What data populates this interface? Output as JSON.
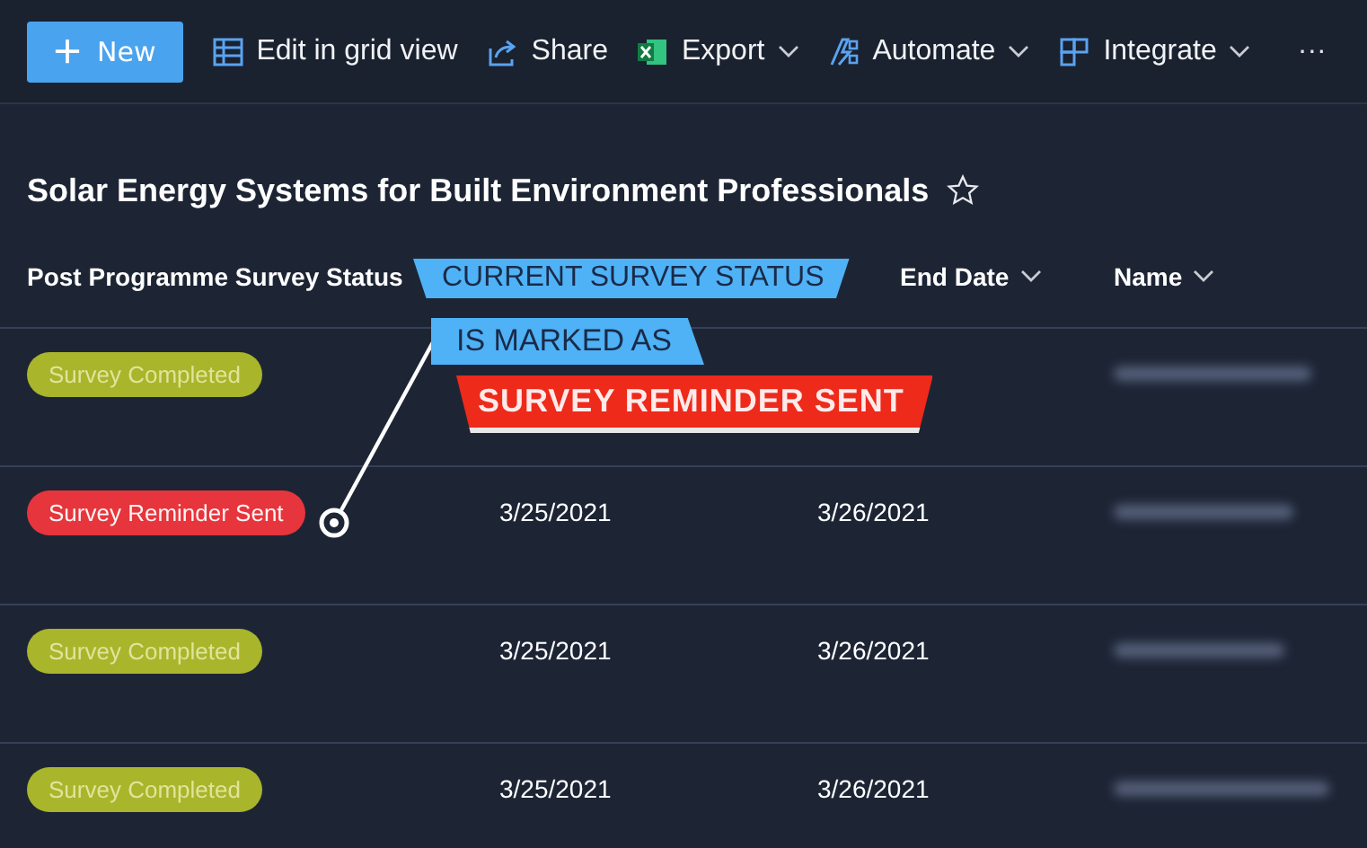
{
  "toolbar": {
    "new_button": "New",
    "items": [
      {
        "kind": "grid",
        "label": "Edit in grid view"
      },
      {
        "kind": "share",
        "label": "Share"
      },
      {
        "kind": "excel",
        "label": "Export",
        "dropdown": true
      },
      {
        "kind": "automate",
        "label": "Automate",
        "dropdown": true
      },
      {
        "kind": "integrate",
        "label": "Integrate",
        "dropdown": true
      }
    ],
    "more": "···"
  },
  "list_title": "Solar Energy Systems for Built Environment Professionals",
  "favorite": false,
  "table": {
    "columns": [
      {
        "label": "Post Programme Survey Status",
        "sortable": false
      },
      {
        "label": "End Date",
        "sortable": true
      },
      {
        "label": "Name",
        "sortable": true
      }
    ],
    "rows": [
      {
        "status": {
          "text": "Survey Completed",
          "color": "#a9b52b"
        }
      },
      {
        "status": {
          "text": "Survey Reminder Sent",
          "color": "#e6353c"
        },
        "start_date": "3/25/2021",
        "end_date": "3/26/2021"
      },
      {
        "status": {
          "text": "Survey Completed",
          "color": "#a9b52b"
        },
        "start_date": "3/25/2021",
        "end_date": "3/26/2021"
      },
      {
        "status": {
          "text": "Survey Completed",
          "color": "#a9b52b"
        },
        "start_date": "3/25/2021",
        "end_date": "3/26/2021"
      }
    ]
  },
  "annotation": {
    "lines": [
      "CURRENT SURVEY STATUS",
      "IS MARKED AS"
    ],
    "highlight": "SURVEY REMINDER SENT"
  }
}
